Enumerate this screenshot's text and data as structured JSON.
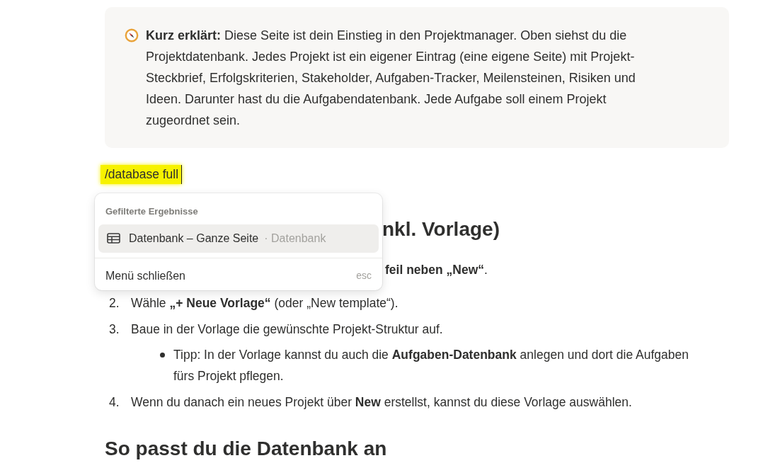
{
  "callout": {
    "text": "**Kurz erklärt:** Diese Seite ist dein Einstieg in den Projektmanager. Oben siehst du die Projektdatenbank. Jedes Projekt ist ein eigener Eintrag (eine eigene Seite) mit Projekt-Steckbrief, Erfolgskriterien, Stakeholder, Aufgaben-Tracker, Meilensteinen, Risiken und Ideen. Darunter hast du die Aufgabendatenbank. Jede Aufgabe soll einem Projekt zugeordnet sein."
  },
  "slash_command": {
    "text": "/database full"
  },
  "menu": {
    "section_label": "Gefilterte Ergebnisse",
    "items": [
      {
        "label": "Datenbank – Ganze Seite",
        "type_label": "· Datenbank",
        "selected": true
      }
    ],
    "close_label": "Menü schließen",
    "close_shortcut": "esc"
  },
  "heading_fragment": "nkl. Vorlage)",
  "steps": [
    {
      "text": "**feil neben „New“**."
    },
    {
      "number": "2.",
      "text": "Wähle **„+ Neue Vorlage“** (oder „New template“)."
    },
    {
      "number": "3.",
      "text": "Baue in der Vorlage die gewünschte Projekt-Struktur auf.",
      "children": [
        {
          "text": "Tipp: In der Vorlage kannst du auch die **Aufgaben-Datenbank** anlegen und dort die Aufgaben fürs Projekt pflegen."
        }
      ]
    },
    {
      "number": "4.",
      "text": "Wenn du danach ein neues Projekt über **New** erstellst, kannst du diese Vorlage auswählen."
    }
  ],
  "heading2": "So passt du die Datenbank an"
}
